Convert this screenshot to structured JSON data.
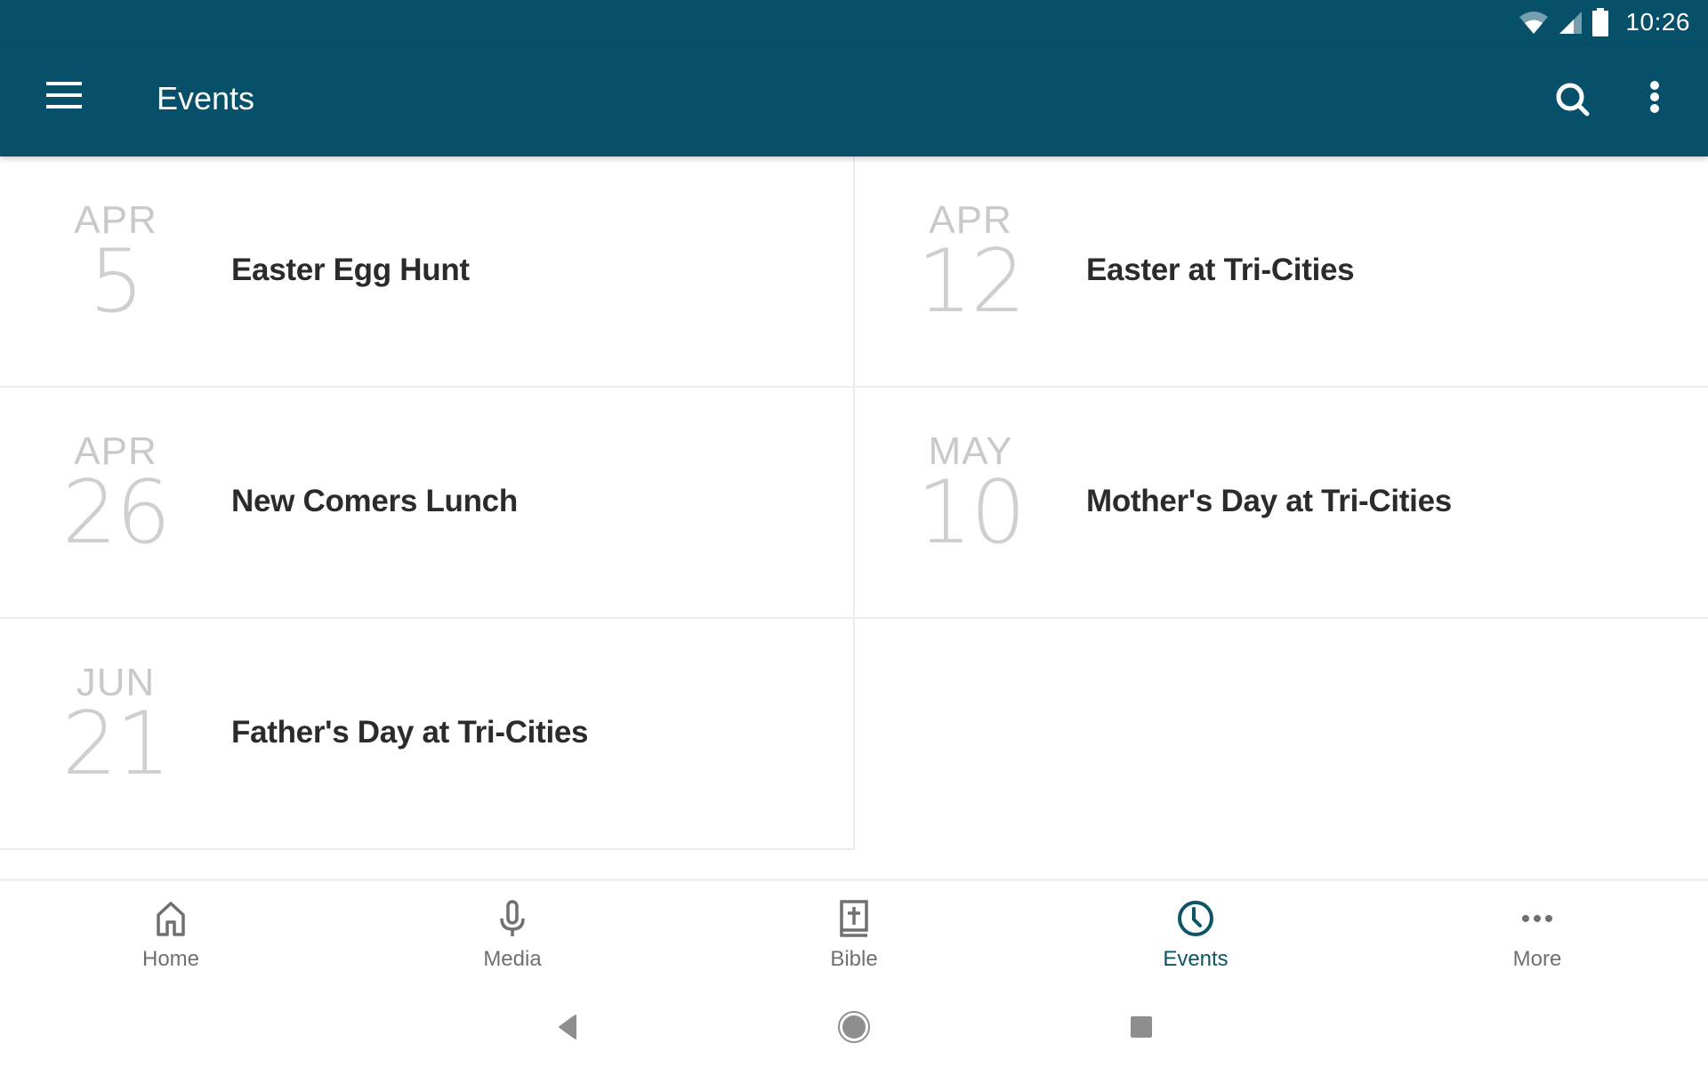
{
  "status_bar": {
    "time": "10:26",
    "icons": [
      "wifi-icon",
      "cell-signal-icon",
      "battery-icon"
    ]
  },
  "app_bar": {
    "title": "Events",
    "menu_icon": "hamburger-menu-icon",
    "search_icon": "search-icon",
    "overflow_icon": "more-vert-icon"
  },
  "events": [
    {
      "month": "APR",
      "day": "5",
      "title": "Easter Egg Hunt"
    },
    {
      "month": "APR",
      "day": "12",
      "title": "Easter at Tri-Cities"
    },
    {
      "month": "APR",
      "day": "26",
      "title": "New Comers Lunch"
    },
    {
      "month": "MAY",
      "day": "10",
      "title": "Mother's Day at Tri-Cities"
    },
    {
      "month": "JUN",
      "day": "21",
      "title": "Father's Day at Tri-Cities"
    }
  ],
  "bottom_nav": {
    "items": [
      {
        "label": "Home",
        "icon": "home-icon",
        "active": false
      },
      {
        "label": "Media",
        "icon": "microphone-icon",
        "active": false
      },
      {
        "label": "Bible",
        "icon": "bible-icon",
        "active": false
      },
      {
        "label": "Events",
        "icon": "clock-icon",
        "active": true
      },
      {
        "label": "More",
        "icon": "more-horiz-icon",
        "active": false
      }
    ]
  },
  "system_nav": {
    "back": "back-icon",
    "home": "home-circle-icon",
    "recents": "recents-icon"
  },
  "colors": {
    "primary": "#06506a",
    "active_nav": "#0d5566",
    "inactive_nav": "#707070",
    "date_text": "#c9c9c9",
    "title_text": "#2b2b2b"
  }
}
